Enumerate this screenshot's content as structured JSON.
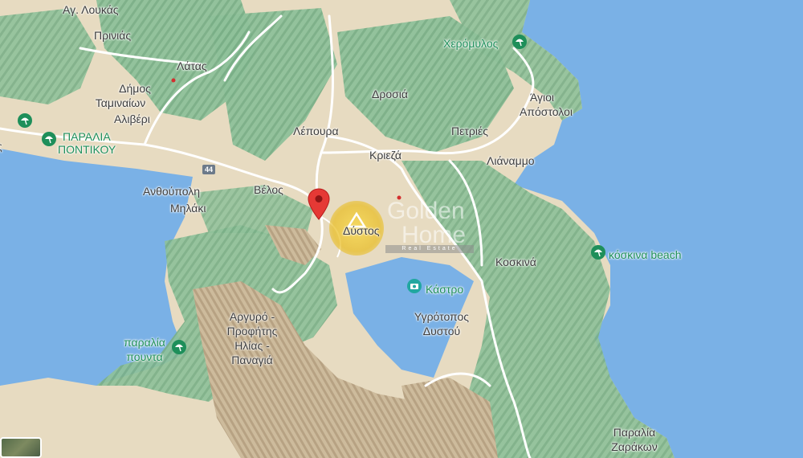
{
  "map": {
    "labels": {
      "ag_loukas": "Αγ. Λουκάς",
      "prinias": "Πρινιάς",
      "latas": "Λάτας",
      "dimos": "Δήμος",
      "taminaion": "Ταμιναίων",
      "aliveri": "Αλιβέρι",
      "paralia_pontikou_1": "ΠΑΡΑΛΙΑ",
      "paralia_pontikou_2": "ΠΟΝΤΙΚΟΥ",
      "anthoupoli": "Ανθούπολη",
      "milaki": "Μηλάκι",
      "velos": "Βέλος",
      "lepoura": "Λέπουρα",
      "drosia": "Δροσιά",
      "kriezá": "Κριεζά",
      "petries": "Πετριές",
      "agioi_apostoloi_1": "Άγιοι",
      "agioi_apostoloi_2": "Απόστολοι",
      "lianammo": "Λιάναμμο",
      "xeromylos": "Χερόμυλος",
      "dystos": "Δύστος",
      "koskina": "Κοσκινά",
      "koskina_beach": "κόσκινα beach",
      "kastro": "Κάστρο",
      "ygrotopos_1": "Υγρότοπος",
      "ygrotopos_2": "Δυστού",
      "argyro_1": "Αργυρό -",
      "argyro_2": "Προφήτης",
      "argyro_3": "Ηλίας -",
      "argyro_4": "Παναγιά",
      "paralia_pounta_1": "παραλία",
      "paralia_pounta_2": "πουντα",
      "paralia_zarakon_1": "Παραλία",
      "paralia_zarakon_2": "Ζαράκων",
      "left_edge_1": "ς"
    },
    "road_shield": "44",
    "watermark": {
      "brand": "Golden",
      "brand2": "Home",
      "sub": "Real Estate"
    },
    "colors": {
      "water": "#7ab1e6",
      "land": "#e8dcc3",
      "forest": "#9cc9a2",
      "beach_poi": "#1e8f5a",
      "pin": "#e53935"
    }
  }
}
